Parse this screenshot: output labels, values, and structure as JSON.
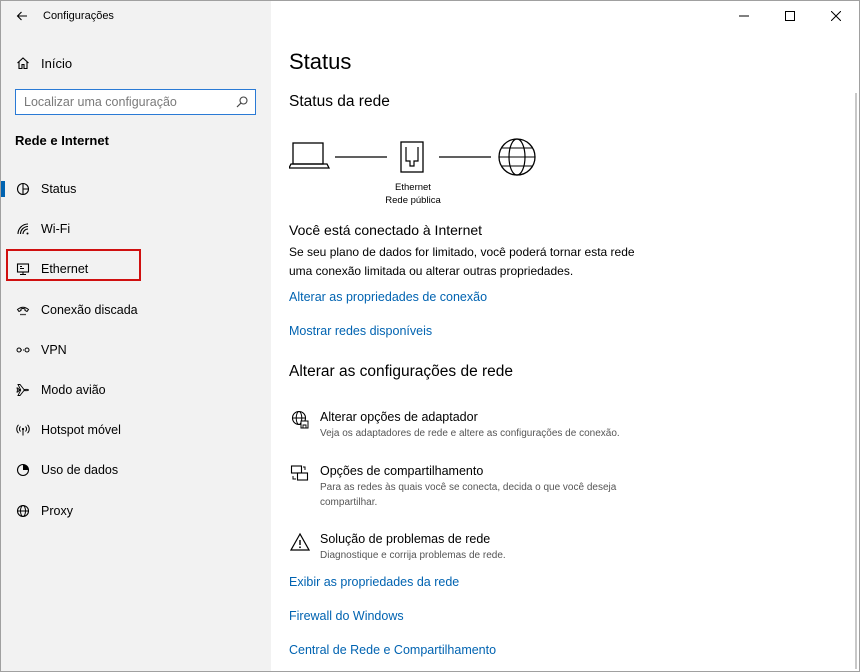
{
  "window": {
    "title": "Configurações"
  },
  "sidebar": {
    "home_label": "Início",
    "search_placeholder": "Localizar uma configuração",
    "section_title": "Rede e Internet",
    "items": [
      {
        "label": "Status",
        "icon": "status-icon"
      },
      {
        "label": "Wi-Fi",
        "icon": "wifi-icon"
      },
      {
        "label": "Ethernet",
        "icon": "ethernet-icon"
      },
      {
        "label": "Conexão discada",
        "icon": "dialup-icon"
      },
      {
        "label": "VPN",
        "icon": "vpn-icon"
      },
      {
        "label": "Modo avião",
        "icon": "airplane-icon"
      },
      {
        "label": "Hotspot móvel",
        "icon": "hotspot-icon"
      },
      {
        "label": "Uso de dados",
        "icon": "data-usage-icon"
      },
      {
        "label": "Proxy",
        "icon": "globe-icon"
      }
    ],
    "active_index": 0,
    "highlighted_index": 6
  },
  "main": {
    "title": "Status",
    "network_status_heading": "Status da rede",
    "adapter_name": "Ethernet",
    "network_type": "Rede pública",
    "connected_title": "Você está conectado à Internet",
    "connected_desc": "Se seu plano de dados for limitado, você poderá tornar esta rede uma conexão limitada ou alterar outras propriedades.",
    "link_change_props": "Alterar as propriedades de conexão",
    "link_show_networks": "Mostrar redes disponíveis",
    "change_heading": "Alterar as configurações de rede",
    "options": [
      {
        "title": "Alterar opções de adaptador",
        "desc": "Veja os adaptadores de rede e altere as configurações de conexão.",
        "icon": "adapter-icon"
      },
      {
        "title": "Opções de compartilhamento",
        "desc": "Para as redes às quais você se conecta, decida o que você deseja compartilhar.",
        "icon": "sharing-icon"
      },
      {
        "title": "Solução de problemas de rede",
        "desc": "Diagnostique e corrija problemas de rede.",
        "icon": "warning-icon"
      }
    ],
    "link_view_props": "Exibir as propriedades da rede",
    "link_firewall": "Firewall do Windows",
    "link_network_center": "Central de Rede e Compartilhamento"
  },
  "colors": {
    "accent": "#0063b1",
    "sidebar_bg": "#f2f2f2",
    "highlight": "#d01010"
  }
}
